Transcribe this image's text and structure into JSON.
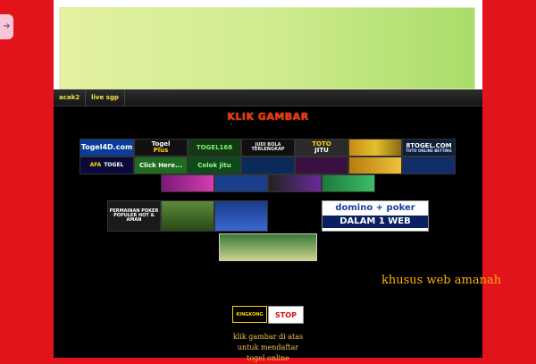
{
  "nav": {
    "items": [
      "acak2",
      "live sgp"
    ]
  },
  "title": "KLIK GAMBAR",
  "dot": "'",
  "banners": {
    "togel4d": "Togel4D.com",
    "afa": "AFA",
    "afa_sub": "TOGEL",
    "togelplus": "Togel",
    "togelplus_sub": "Plus",
    "clickhere": "Click Here...",
    "togel168": "TOGEL168",
    "colokjitu": "Colok jitu",
    "judibola": "JUDI BOLA TERLENGKAP",
    "totojitu_1": "TOTO",
    "totojitu_2": "JITU",
    "btogel": "8TOGEL.COM",
    "btogel_sub": "TOTO ONLINE BETTING",
    "poker_text": "PERMAINAN POKER POPULER HOT & AMAN",
    "domino_1": "domino + poker",
    "domino_2": "DALAM 1 WEB"
  },
  "promo": "khusus web amanah",
  "kingkong": "KINGKONG",
  "stop": "STOP",
  "footer": [
    "klik gambar di atas",
    "untuk mendaftar",
    "togel online"
  ],
  "colors": {
    "background": "#e3131b",
    "title": "#ff2a1a",
    "nav_text": "#f2e24a",
    "promo": "#ffae0a",
    "footer": "#f0c34a"
  }
}
